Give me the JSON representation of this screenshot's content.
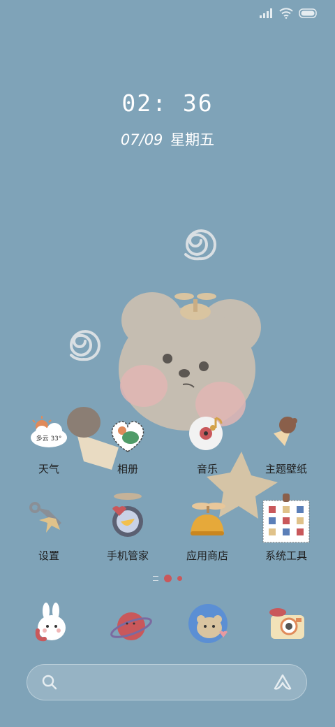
{
  "status_bar": {
    "icons": [
      "signal-icon",
      "wifi-icon",
      "battery-icon"
    ]
  },
  "lockscreen": {
    "time": "02: 36",
    "date": "07/09",
    "weekday": "星期五"
  },
  "weather_widget": {
    "text": "多云 33°"
  },
  "apps": [
    {
      "label": "天气",
      "icon": "weather-icon"
    },
    {
      "label": "相册",
      "icon": "gallery-icon"
    },
    {
      "label": "音乐",
      "icon": "music-icon"
    },
    {
      "label": "主题壁纸",
      "icon": "theme-icon"
    },
    {
      "label": "设置",
      "icon": "settings-icon"
    },
    {
      "label": "手机管家",
      "icon": "security-icon"
    },
    {
      "label": "应用商店",
      "icon": "app-store-icon"
    },
    {
      "label": "系统工具",
      "icon": "system-tools-icon"
    }
  ],
  "page_indicator": {
    "pages": 2,
    "active": 1
  },
  "dock": [
    {
      "icon": "phone-bunny-icon"
    },
    {
      "icon": "messages-planet-icon"
    },
    {
      "icon": "browser-bear-icon"
    },
    {
      "icon": "camera-icon"
    }
  ],
  "search": {
    "icons": [
      "search-icon",
      "assistant-icon"
    ]
  },
  "colors": {
    "background": "#7fa3b8",
    "label": "#1f1f1f",
    "accent": "#c9585b"
  }
}
